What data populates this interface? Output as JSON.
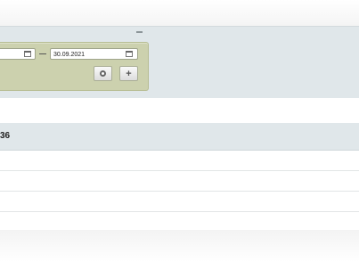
{
  "filter": {
    "date_from": "",
    "date_to": "30.09.2021"
  },
  "table": {
    "header_text": "36",
    "rows": [
      "",
      "",
      "",
      ""
    ]
  }
}
